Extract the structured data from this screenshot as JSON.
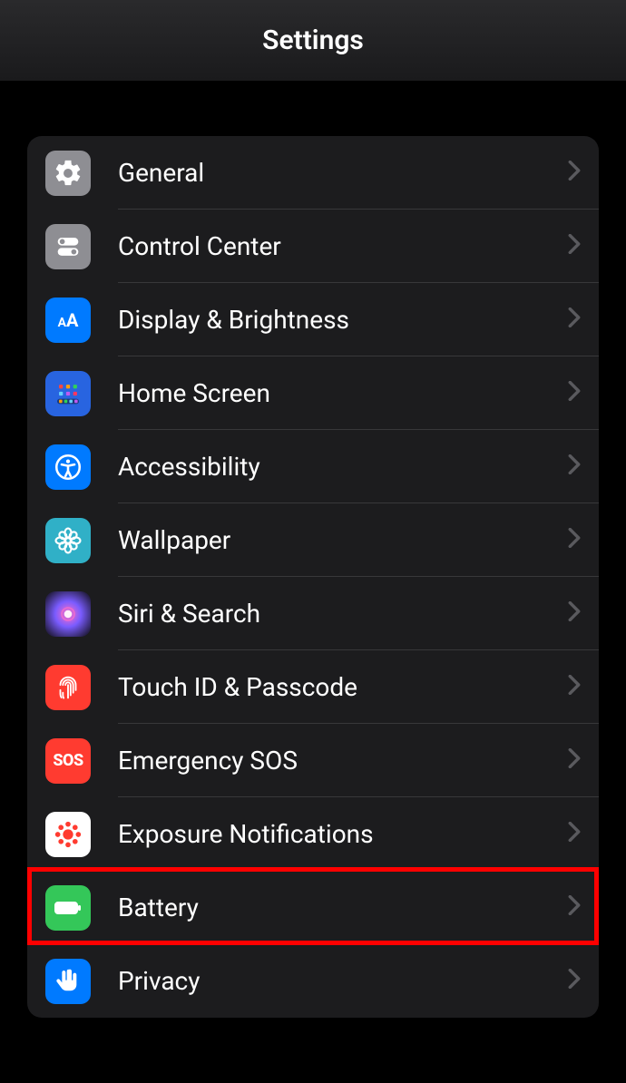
{
  "header": {
    "title": "Settings"
  },
  "rows": [
    {
      "id": "general",
      "label": "General"
    },
    {
      "id": "control-center",
      "label": "Control Center"
    },
    {
      "id": "display-brightness",
      "label": "Display & Brightness"
    },
    {
      "id": "home-screen",
      "label": "Home Screen"
    },
    {
      "id": "accessibility",
      "label": "Accessibility"
    },
    {
      "id": "wallpaper",
      "label": "Wallpaper"
    },
    {
      "id": "siri-search",
      "label": "Siri & Search"
    },
    {
      "id": "touch-id",
      "label": "Touch ID & Passcode"
    },
    {
      "id": "emergency-sos",
      "label": "Emergency SOS",
      "sos": "SOS"
    },
    {
      "id": "exposure",
      "label": "Exposure Notifications"
    },
    {
      "id": "battery",
      "label": "Battery"
    },
    {
      "id": "privacy",
      "label": "Privacy"
    }
  ]
}
